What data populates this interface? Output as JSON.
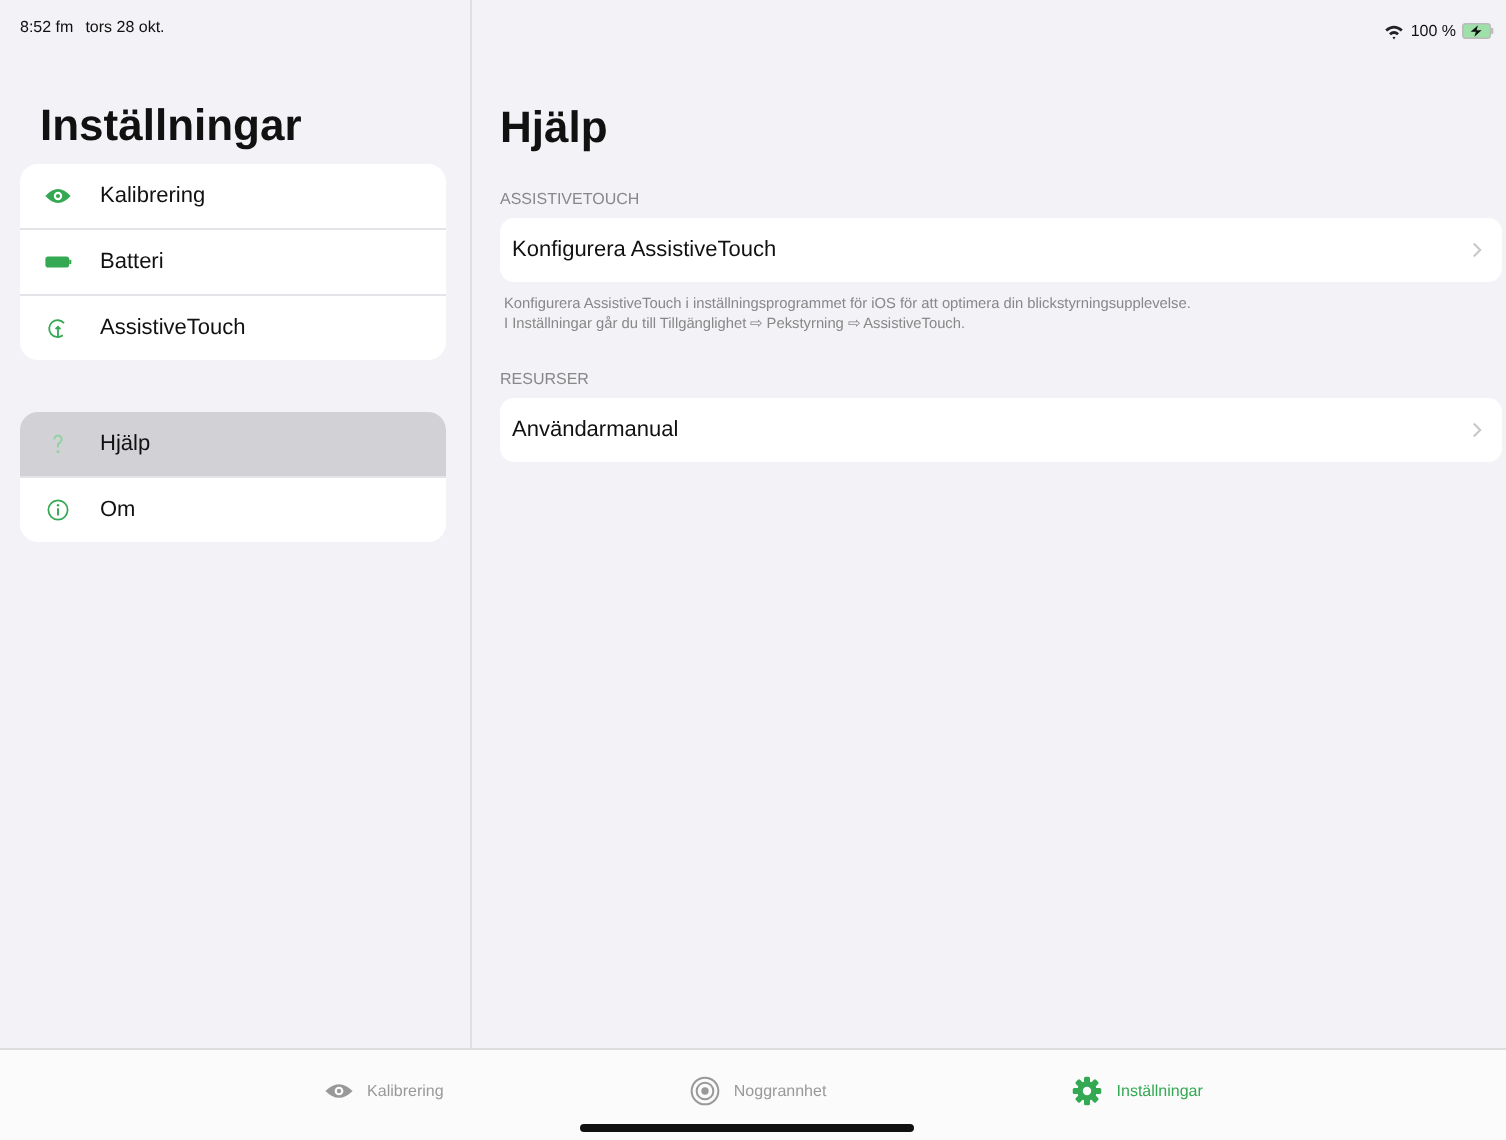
{
  "status_bar": {
    "time": "8:52 fm",
    "date": "tors 28 okt.",
    "battery": "100 %"
  },
  "sidebar": {
    "title": "Inställningar",
    "groups": [
      {
        "items": [
          {
            "label": "Kalibrering",
            "kind": "eye",
            "selected": false
          },
          {
            "label": "Batteri",
            "kind": "battery",
            "selected": false
          },
          {
            "label": "AssistiveTouch",
            "kind": "touch",
            "selected": false
          }
        ]
      },
      {
        "items": [
          {
            "label": "Hjälp",
            "kind": "question",
            "selected": true
          },
          {
            "label": "Om",
            "kind": "info",
            "selected": false
          }
        ]
      }
    ]
  },
  "detail": {
    "title": "Hjälp",
    "sections": [
      {
        "header": "ASSISTIVETOUCH",
        "rows": [
          {
            "label": "Konfigurera AssistiveTouch"
          }
        ],
        "footer": [
          "Konfigurera AssistiveTouch i inställningsprogrammet för iOS för att optimera din blickstyrningsupplevelse.",
          "I Inställningar går du till Tillgänglighet ⇨ Pekstyrning ⇨ AssistiveTouch."
        ]
      },
      {
        "header": "RESURSER",
        "rows": [
          {
            "label": "Användarmanual"
          }
        ]
      }
    ]
  },
  "tab_bar": [
    {
      "label": "Kalibrering",
      "kind": "eye",
      "selected": false
    },
    {
      "label": "Noggrannhet",
      "kind": "target",
      "selected": false
    },
    {
      "label": "Inställningar",
      "kind": "gear",
      "selected": true
    }
  ]
}
